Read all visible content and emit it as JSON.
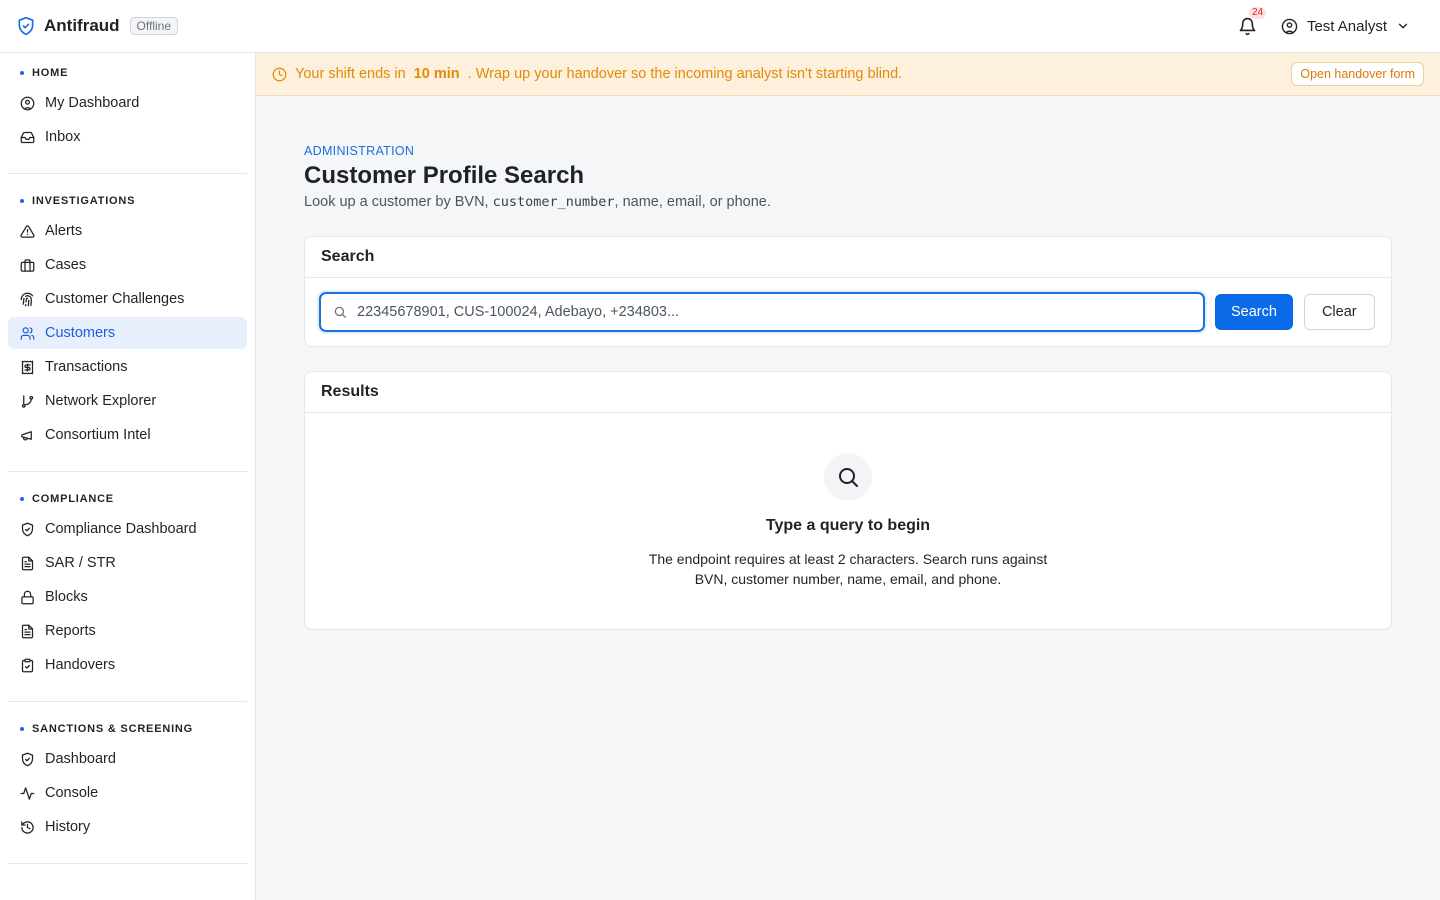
{
  "app": {
    "name": "Antifraud",
    "status": "Offline",
    "notification_count": "24",
    "user_name": "Test Analyst"
  },
  "banner": {
    "prefix": "Your shift ends in",
    "time": "10 min",
    "suffix": ". Wrap up your handover so the incoming analyst isn't starting blind.",
    "button": "Open handover form"
  },
  "sidebar": {
    "sections": [
      {
        "title": "HOME",
        "items": [
          {
            "label": "My Dashboard",
            "icon": "user-circle-icon"
          },
          {
            "label": "Inbox",
            "icon": "inbox-icon"
          }
        ]
      },
      {
        "title": "INVESTIGATIONS",
        "items": [
          {
            "label": "Alerts",
            "icon": "alert-triangle-icon"
          },
          {
            "label": "Cases",
            "icon": "briefcase-icon"
          },
          {
            "label": "Customer Challenges",
            "icon": "fingerprint-icon"
          },
          {
            "label": "Customers",
            "icon": "users-icon",
            "active": true
          },
          {
            "label": "Transactions",
            "icon": "receipt-icon"
          },
          {
            "label": "Network Explorer",
            "icon": "git-branch-icon"
          },
          {
            "label": "Consortium Intel",
            "icon": "megaphone-icon"
          }
        ]
      },
      {
        "title": "COMPLIANCE",
        "items": [
          {
            "label": "Compliance Dashboard",
            "icon": "shield-check-icon"
          },
          {
            "label": "SAR / STR",
            "icon": "file-text-icon"
          },
          {
            "label": "Blocks",
            "icon": "lock-icon"
          },
          {
            "label": "Reports",
            "icon": "file-text-icon"
          },
          {
            "label": "Handovers",
            "icon": "clipboard-check-icon"
          }
        ]
      },
      {
        "title": "SANCTIONS & SCREENING",
        "items": [
          {
            "label": "Dashboard",
            "icon": "shield-check-icon"
          },
          {
            "label": "Console",
            "icon": "activity-icon"
          },
          {
            "label": "History",
            "icon": "history-icon"
          }
        ]
      }
    ]
  },
  "page": {
    "eyebrow": "ADMINISTRATION",
    "title": "Customer Profile Search",
    "subtitle_before": "Look up a customer by BVN,",
    "subtitle_code": "customer_number",
    "subtitle_after": ", name, email, or phone."
  },
  "search_card": {
    "title": "Search",
    "placeholder": "22345678901, CUS-100024, Adebayo, +234803...",
    "value": "",
    "search_button": "Search",
    "clear_button": "Clear"
  },
  "results_card": {
    "title": "Results",
    "empty_title": "Type a query to begin",
    "empty_desc": "The endpoint requires at least 2 characters. Search runs against BVN, customer number, name, email, and phone."
  },
  "colors": {
    "accent": "#0b6ae6",
    "banner_bg": "#fdf0dd",
    "banner_text": "#e38a09",
    "active_bg": "#e7effd"
  }
}
